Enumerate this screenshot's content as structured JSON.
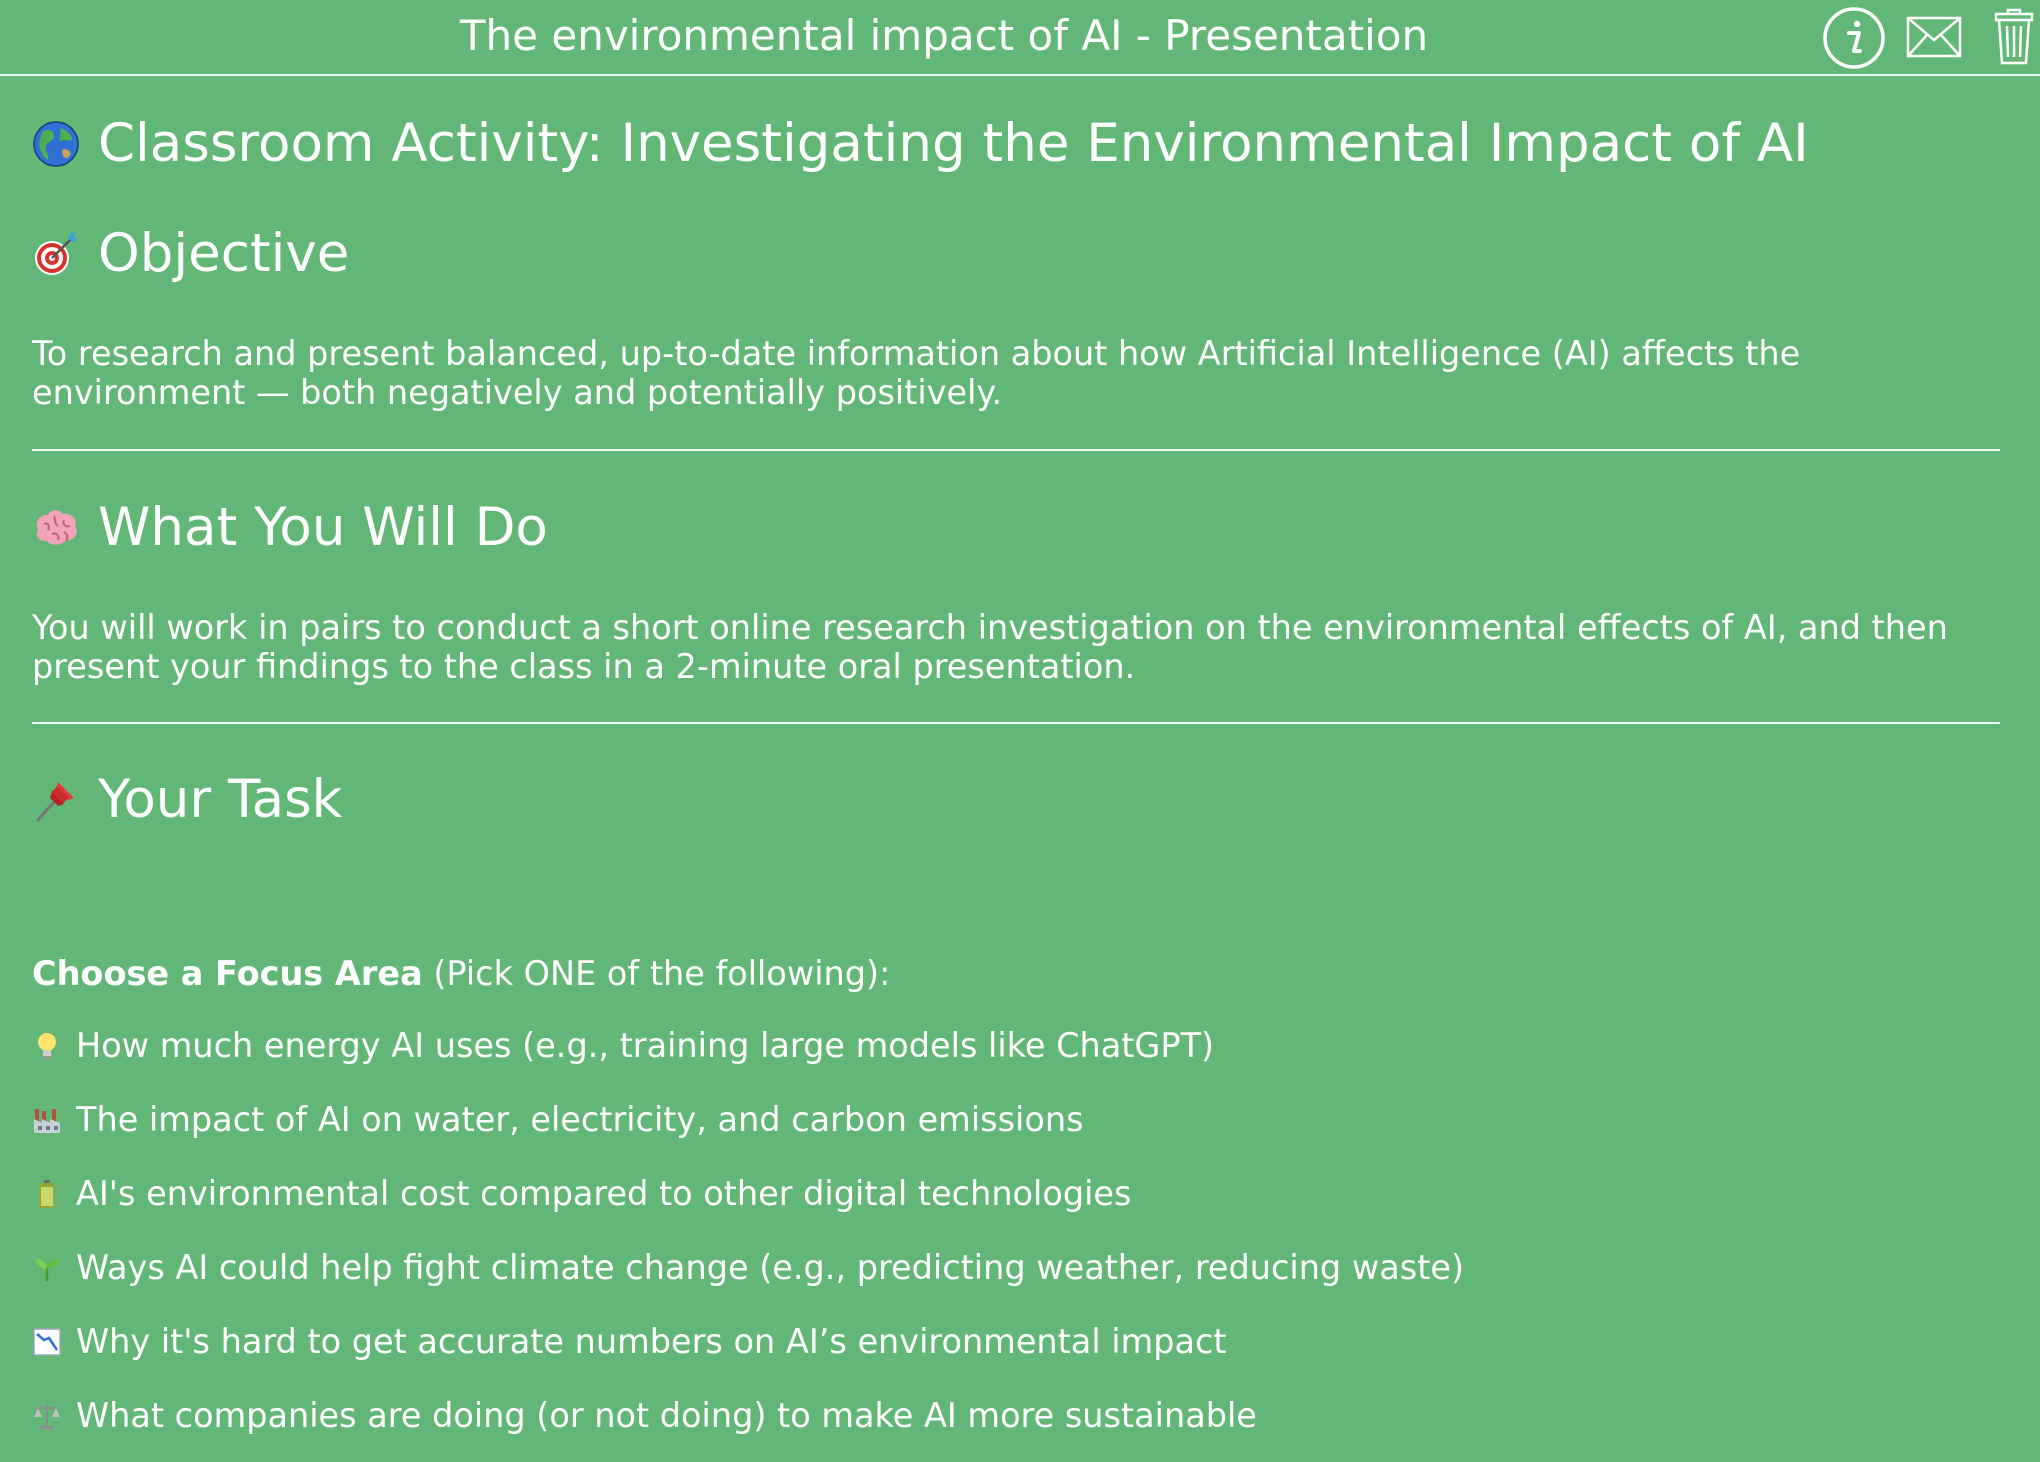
{
  "window": {
    "title": "The environmental impact of AI - Presentation"
  },
  "toolbar": {
    "info_icon": "info-circle-icon",
    "mail_icon": "envelope-icon",
    "trash_icon": "trash-icon"
  },
  "page": {
    "title": "Classroom Activity: Investigating the Environmental Impact of AI",
    "title_icon": "globe-icon",
    "sections": [
      {
        "heading": "Objective",
        "icon": "target-icon",
        "body": "To research and present balanced, up-to-date information about how Artificial Intelligence (AI) affects the environment — both negatively and potentially positively."
      },
      {
        "heading": "What You Will Do",
        "icon": "brain-icon",
        "body": "You will work in pairs to conduct a short online research investigation on the environmental effects of AI, and then present your findings to the class in a 2-minute oral presentation."
      },
      {
        "heading": "Your Task",
        "icon": "pushpin-icon"
      }
    ],
    "focus": {
      "label_bold": "Choose a Focus Area",
      "label_rest": " (Pick ONE of the following):",
      "options": [
        {
          "icon": "lightbulb-icon",
          "text": "How much energy AI uses (e.g., training large models like ChatGPT)"
        },
        {
          "icon": "factory-icon",
          "text": "The impact of AI on water, electricity, and carbon emissions"
        },
        {
          "icon": "battery-icon",
          "text": "AI's environmental cost compared to other digital technologies"
        },
        {
          "icon": "seedling-icon",
          "text": "Ways AI could help fight climate change (e.g., predicting weather, reducing waste)"
        },
        {
          "icon": "chart-decreasing-icon",
          "text": "Why it's hard to get accurate numbers on AI’s environmental impact"
        },
        {
          "icon": "balance-scale-icon",
          "text": "What companies are doing (or not doing) to make AI more sustainable"
        }
      ]
    }
  },
  "colors": {
    "background": "#62b776",
    "text": "#ffffff"
  }
}
